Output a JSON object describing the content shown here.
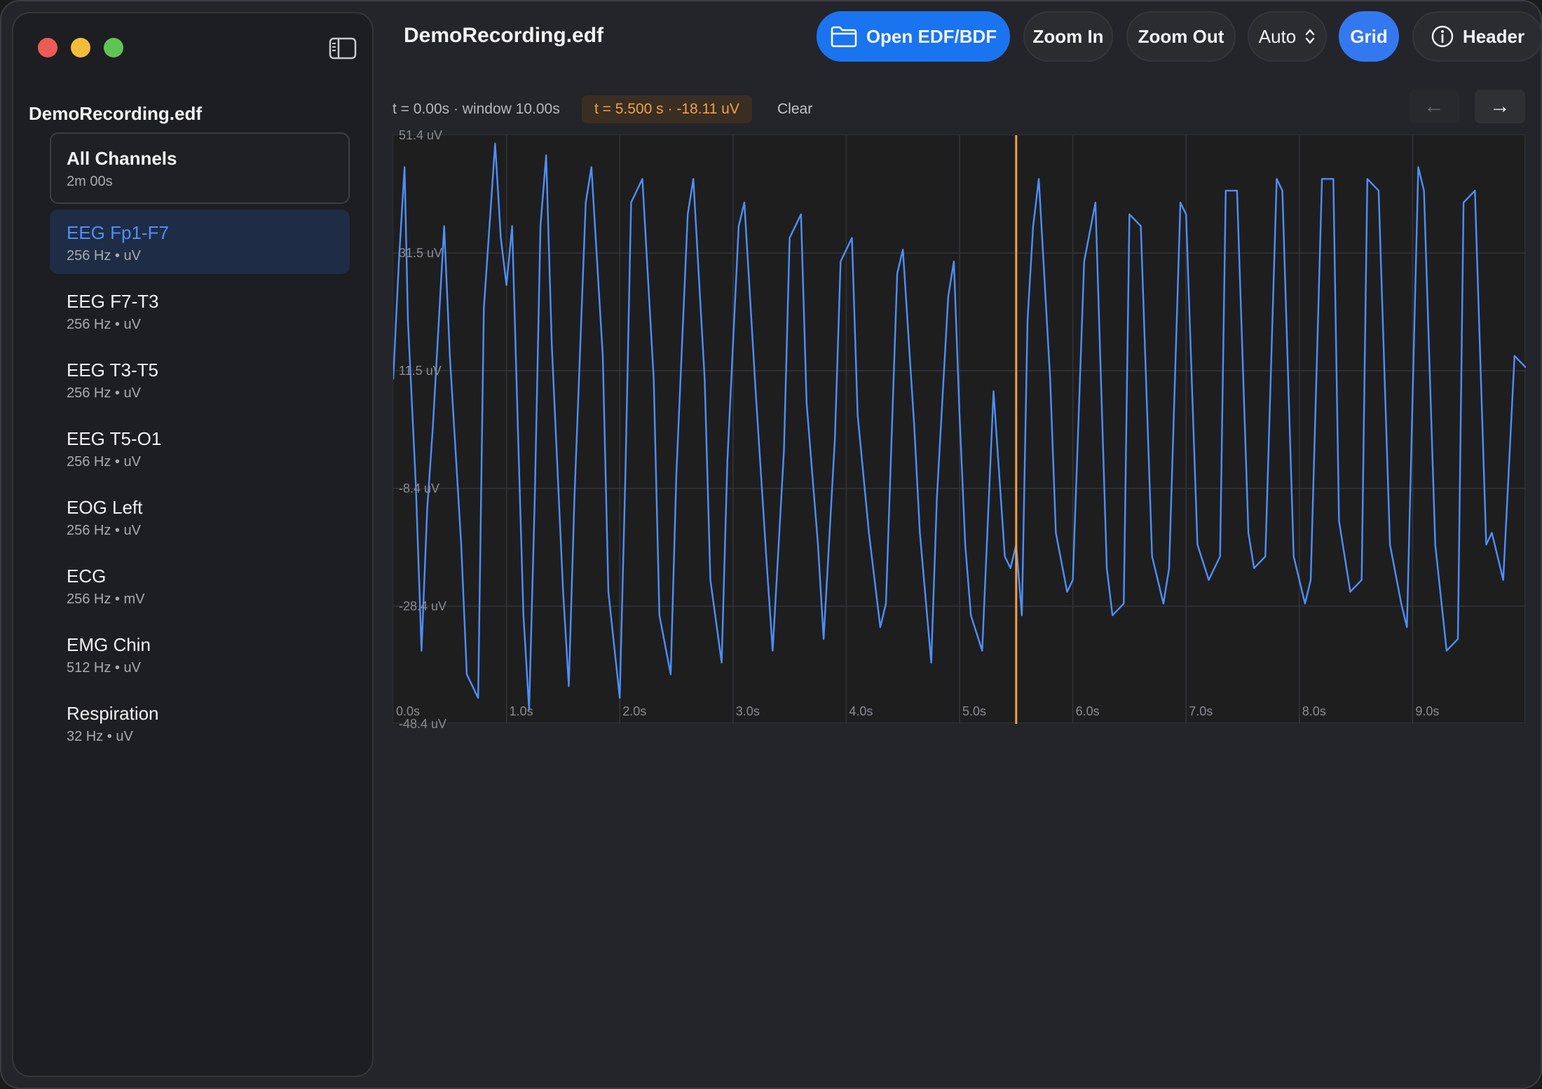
{
  "app": {
    "file_title": "DemoRecording.edf"
  },
  "sidebar": {
    "title": "DemoRecording.edf",
    "all_channels": {
      "label": "All Channels",
      "duration": "2m 00s"
    },
    "channels": [
      {
        "name": "EEG Fp1-F7",
        "info": "256 Hz • uV",
        "selected": true
      },
      {
        "name": "EEG F7-T3",
        "info": "256 Hz • uV"
      },
      {
        "name": "EEG T3-T5",
        "info": "256 Hz • uV"
      },
      {
        "name": "EEG T5-O1",
        "info": "256 Hz • uV"
      },
      {
        "name": "EOG Left",
        "info": "256 Hz • uV"
      },
      {
        "name": "ECG",
        "info": "256 Hz • mV"
      },
      {
        "name": "EMG Chin",
        "info": "512 Hz • uV"
      },
      {
        "name": "Respiration",
        "info": "32 Hz • uV"
      }
    ]
  },
  "toolbar": {
    "open_label": "Open EDF/BDF",
    "zoom_in_label": "Zoom In",
    "zoom_out_label": "Zoom Out",
    "scale_label": "Auto",
    "grid_label": "Grid",
    "header_label": "Header"
  },
  "viewer": {
    "time_info": "t = 0.00s · window 10.00s",
    "cursor_readout": "t = 5.500 s · -18.11 uV",
    "clear_label": "Clear",
    "prev_arrow": "←",
    "next_arrow": "→"
  },
  "colors": {
    "signal": "#4f8ff7",
    "cursor": "#f0a049",
    "accent": "#1a74f0"
  },
  "chart_data": {
    "type": "line",
    "y_tick_labels": [
      "51.4 uV",
      "31.5 uV",
      "11.5 uV",
      "-8.4 uV",
      "-28.4 uV",
      "-48.4 uV"
    ],
    "x_tick_labels": [
      "0.0s",
      "1.0s",
      "2.0s",
      "3.0s",
      "4.0s",
      "5.0s",
      "6.0s",
      "7.0s",
      "8.0s",
      "9.0s"
    ],
    "ylim": [
      -48.4,
      51.4
    ],
    "xlim": [
      0,
      10
    ],
    "cursor_x": 5.5,
    "grid": true,
    "series": [
      {
        "x": [
          0.0,
          0.05,
          0.1,
          0.13,
          0.2,
          0.25,
          0.3,
          0.35,
          0.45,
          0.5,
          0.6,
          0.65,
          0.75,
          0.8,
          0.9,
          0.95,
          1.0,
          1.05,
          1.1,
          1.15,
          1.2,
          1.25,
          1.3,
          1.35,
          1.4,
          1.5,
          1.55,
          1.6,
          1.7,
          1.75,
          1.85,
          1.9,
          2.0,
          2.05,
          2.1,
          2.2,
          2.3,
          2.35,
          2.45,
          2.5,
          2.6,
          2.65,
          2.75,
          2.8,
          2.9,
          2.95,
          3.05,
          3.1,
          3.2,
          3.3,
          3.35,
          3.45,
          3.5,
          3.6,
          3.65,
          3.75,
          3.8,
          3.9,
          3.95,
          4.05,
          4.1,
          4.2,
          4.3,
          4.35,
          4.45,
          4.5,
          4.6,
          4.65,
          4.75,
          4.8,
          4.9,
          4.95,
          5.0,
          5.05,
          5.1,
          5.2,
          5.3,
          5.4,
          5.45,
          5.5,
          5.55,
          5.6,
          5.65,
          5.7,
          5.8,
          5.85,
          5.95,
          6.0,
          6.1,
          6.2,
          6.3,
          6.35,
          6.45,
          6.5,
          6.6,
          6.7,
          6.8,
          6.85,
          6.95,
          7.0,
          7.1,
          7.2,
          7.3,
          7.35,
          7.45,
          7.55,
          7.6,
          7.7,
          7.8,
          7.85,
          7.95,
          8.05,
          8.1,
          8.2,
          8.3,
          8.35,
          8.45,
          8.55,
          8.6,
          8.7,
          8.8,
          8.9,
          8.95,
          9.05,
          9.1,
          9.2,
          9.3,
          9.4,
          9.45,
          9.55,
          9.65,
          9.7,
          9.8,
          9.9,
          10.0
        ],
        "y": [
          10,
          30,
          46,
          20,
          -8,
          -36,
          -12,
          2,
          36,
          14,
          -18,
          -40,
          -44,
          22,
          50,
          34,
          26,
          36,
          2,
          -30,
          -46,
          -10,
          36,
          48,
          16,
          -26,
          -42,
          -10,
          40,
          46,
          14,
          -26,
          -44,
          -6,
          40,
          44,
          10,
          -30,
          -40,
          -6,
          38,
          44,
          10,
          -24,
          -38,
          -4,
          36,
          40,
          8,
          -22,
          -36,
          -2,
          34,
          38,
          6,
          -18,
          -34,
          0,
          30,
          34,
          4,
          -16,
          -32,
          -28,
          28,
          32,
          2,
          -16,
          -38,
          -10,
          24,
          30,
          4,
          -18,
          -30,
          -36,
          8,
          -20,
          -22,
          -18,
          -30,
          20,
          36,
          44,
          10,
          -16,
          -26,
          -24,
          30,
          40,
          -22,
          -30,
          -28,
          38,
          36,
          -20,
          -28,
          -22,
          40,
          38,
          -18,
          -24,
          -20,
          42,
          42,
          -16,
          -22,
          -20,
          44,
          42,
          -20,
          -28,
          -24,
          44,
          44,
          -14,
          -26,
          -24,
          44,
          42,
          -18,
          -28,
          -32,
          46,
          42,
          -18,
          -36,
          -34,
          40,
          42,
          -18,
          -16,
          -24,
          14,
          12
        ]
      }
    ]
  }
}
